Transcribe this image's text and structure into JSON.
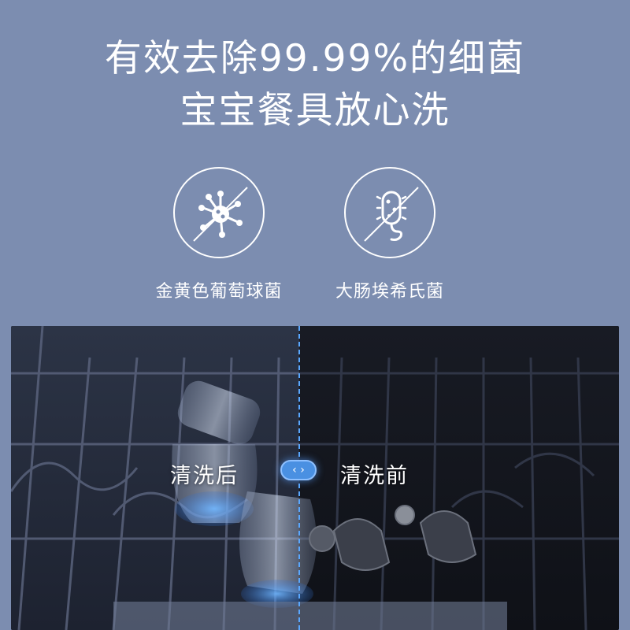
{
  "headline": {
    "line1": "有效去除99.99%的细菌",
    "line2": "宝宝餐具放心洗"
  },
  "bacteria": [
    {
      "label": "金黄色葡萄球菌",
      "icon": "staphylococcus-icon"
    },
    {
      "label": "大肠埃希氏菌",
      "icon": "e-coli-icon"
    }
  ],
  "comparison": {
    "after_label": "清洗后",
    "before_label": "清洗前",
    "handle_glyph": "‹ ›",
    "divider_color": "#5aa8ff"
  },
  "colors": {
    "background": "#7c8db0",
    "text": "#ffffff",
    "accent": "#4a90e2"
  }
}
